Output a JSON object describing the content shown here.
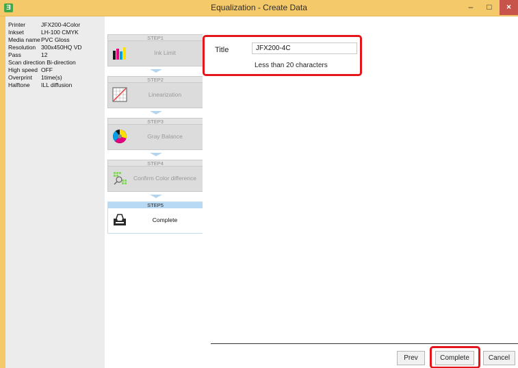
{
  "window": {
    "title": "Equalization - Create Data",
    "app_icon": "Ǝ",
    "min_glyph": "–",
    "max_glyph": "□",
    "close_glyph": "×"
  },
  "info": [
    {
      "label": "Printer",
      "value": "JFX200-4Color"
    },
    {
      "label": "Inkset",
      "value": "LH-100 CMYK"
    },
    {
      "label": "Media name",
      "value": "PVC Gloss"
    },
    {
      "label": "Resolution",
      "value": "300x450HQ VD"
    },
    {
      "label": "Pass",
      "value": "12"
    },
    {
      "label": "Scan direction",
      "value": "Bi-direction"
    },
    {
      "label": "High speed",
      "value": "OFF"
    },
    {
      "label": "Overprint",
      "value": "1time(s)"
    },
    {
      "label": "Halftone",
      "value": "ILL diffusion"
    }
  ],
  "steps": [
    {
      "head": "STEP1",
      "label": "Ink Limit",
      "icon": "ink-limit-icon",
      "active": false
    },
    {
      "head": "STEP2",
      "label": "Linearization",
      "icon": "linearization-icon",
      "active": false
    },
    {
      "head": "STEP3",
      "label": "Gray Balance",
      "icon": "gray-balance-icon",
      "active": false
    },
    {
      "head": "STEP4",
      "label": "Confirm Color difference",
      "icon": "color-difference-icon",
      "active": false
    },
    {
      "head": "STEP5",
      "label": "Complete",
      "icon": "printer-output-icon",
      "active": true
    }
  ],
  "form": {
    "title_label": "Title",
    "title_value": "JFX200-4C",
    "hint": "Less than 20 characters"
  },
  "buttons": {
    "prev": "Prev",
    "complete": "Complete",
    "cancel": "Cancel"
  },
  "colors": {
    "titlebar": "#f4c96a",
    "highlight": "#e3151a",
    "active_step_head": "#b8d9f3"
  }
}
